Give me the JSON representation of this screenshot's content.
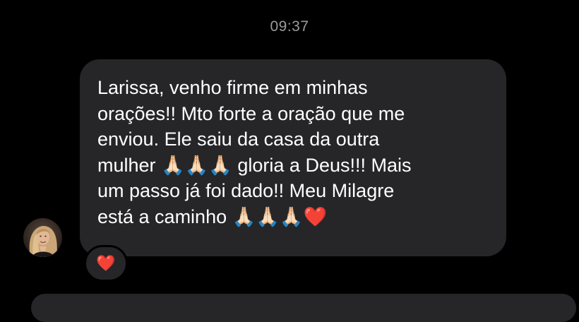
{
  "chat": {
    "timestamp": "09:37",
    "message": {
      "text": "Larissa, venho firme em minhas\norações!! Mto forte a oração que me\nenviou. Ele saiu da casa da outra\nmulher 🙏🏻🙏🏻🙏🏻 gloria a Deus!!! Mais\num passo já foi dado!! Meu Milagre\nestá a caminho 🙏🏻🙏🏻🙏🏻❤️"
    },
    "reaction": {
      "emoji": "❤️"
    }
  },
  "colors": {
    "background": "#000000",
    "bubble": "#262628",
    "timestamp": "#9b9b9f",
    "text": "#ffffff"
  },
  "icons": {
    "avatar": "avatar-photo",
    "reaction": "heart-icon"
  }
}
